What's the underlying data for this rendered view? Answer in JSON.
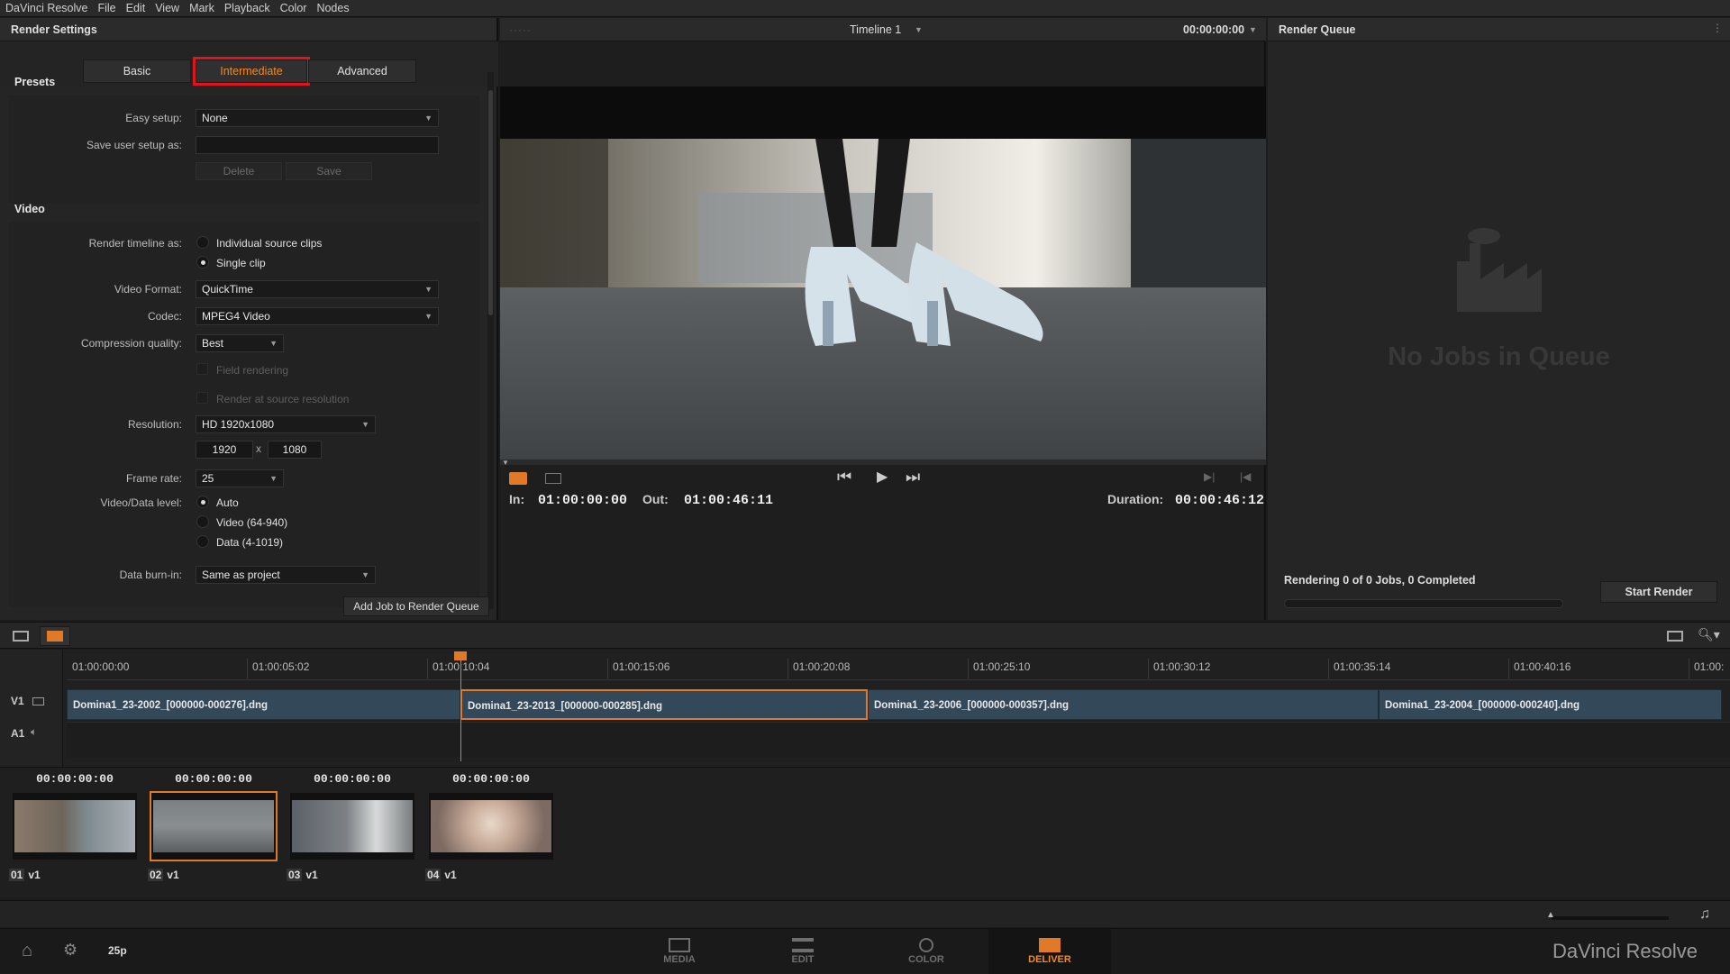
{
  "menubar": [
    "DaVinci Resolve",
    "File",
    "Edit",
    "View",
    "Mark",
    "Playback",
    "Color",
    "Nodes"
  ],
  "render_settings": {
    "title": "Render Settings",
    "tabs": [
      "Basic",
      "Intermediate",
      "Advanced"
    ],
    "presets": {
      "title": "Presets",
      "easy_setup_label": "Easy setup:",
      "easy_setup_value": "None",
      "save_user_setup_label": "Save user setup as:",
      "delete_label": "Delete",
      "save_label": "Save"
    },
    "video": {
      "title": "Video",
      "render_timeline_label": "Render timeline as:",
      "render_options": [
        "Individual source clips",
        "Single clip"
      ],
      "video_format_label": "Video Format:",
      "video_format_value": "QuickTime",
      "codec_label": "Codec:",
      "codec_value": "MPEG4 Video",
      "compression_label": "Compression quality:",
      "compression_value": "Best",
      "field_rendering": "Field rendering",
      "render_source_res": "Render at source resolution",
      "resolution_label": "Resolution:",
      "resolution_value": "HD 1920x1080",
      "width": "1920",
      "x": "x",
      "height": "1080",
      "frame_rate_label": "Frame rate:",
      "frame_rate_value": "25",
      "level_label": "Video/Data level:",
      "level_options": [
        "Auto",
        "Video (64-940)",
        "Data (4-1019)"
      ],
      "burn_in_label": "Data burn-in:",
      "burn_in_value": "Same as project"
    },
    "add_job": "Add Job to Render Queue"
  },
  "viewer": {
    "timeline_name": "Timeline 1",
    "timecode": "00:00:00:00",
    "in_label": "In:",
    "in_value": "01:00:00:00",
    "out_label": "Out:",
    "out_value": "01:00:46:11",
    "duration_label": "Duration:",
    "duration_value": "00:00:46:12"
  },
  "render_queue": {
    "title": "Render Queue",
    "empty": "No Jobs in Queue",
    "status": "Rendering 0 of 0 Jobs, 0 Completed",
    "start_render": "Start Render"
  },
  "timeline": {
    "ticks": [
      "01:00:00:00",
      "01:00:05:02",
      "01:00:10:04",
      "01:00:15:06",
      "01:00:20:08",
      "01:00:25:10",
      "01:00:30:12",
      "01:00:35:14",
      "01:00:40:16",
      "01:00:"
    ],
    "v1": "V1",
    "a1": "A1",
    "clips": [
      "Domina1_23-2002_[000000-000276].dng",
      "Domina1_23-2013_[000000-000285].dng",
      "Domina1_23-2006_[000000-000357].dng",
      "Domina1_23-2004_[000000-000240].dng"
    ]
  },
  "thumbnails": [
    {
      "tc": "00:00:00:00",
      "num": "01",
      "track": "v1"
    },
    {
      "tc": "00:00:00:00",
      "num": "02",
      "track": "v1"
    },
    {
      "tc": "00:00:00:00",
      "num": "03",
      "track": "v1"
    },
    {
      "tc": "00:00:00:00",
      "num": "04",
      "track": "v1"
    }
  ],
  "nav": {
    "fps": "25p",
    "pages": [
      "MEDIA",
      "EDIT",
      "COLOR",
      "DELIVER"
    ],
    "brand": "DaVinci Resolve"
  },
  "colors": {
    "accent": "#f08a28",
    "highlight": "#e1141c",
    "clip": "#33495a"
  }
}
